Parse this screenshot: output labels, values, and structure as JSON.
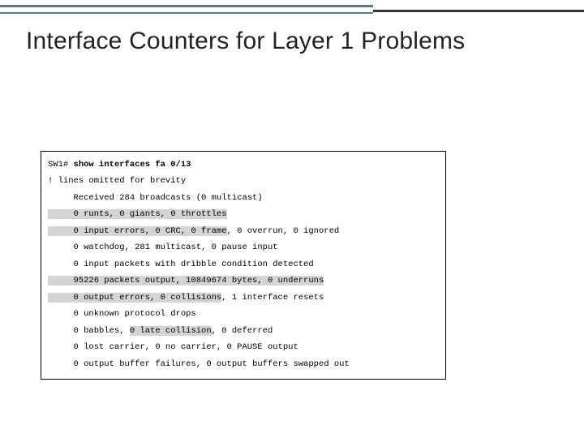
{
  "title": "Interface Counters for Layer 1 Problems",
  "cli": {
    "prompt": "SW1#",
    "command": "show interfaces fa 0/13",
    "omitted": "! lines omitted for brevity",
    "l_recv": "     Received 284 broadcasts (0 multicast)",
    "l_runts_hl": "     0 runts, 0 giants, 0 throttles",
    "l_ie_hl": "     0 input errors, 0 CRC, 0 frame",
    "l_ie_rest": ", 0 overrun, 0 ignored",
    "l_watch": "     0 watchdog, 281 multicast, 0 pause input",
    "l_dribble": "     0 input packets with dribble condition detected",
    "l_pkts_hl": "     95226 packets output, 10849674 bytes, 0 underruns",
    "l_oe_hl": "     0 output errors, 0 collisions",
    "l_oe_rest": ", 1 interface resets",
    "l_unk": "     0 unknown protocol drops",
    "l_bab_pre": "     0 babbles, ",
    "l_latecol_hl": "0 late collision",
    "l_bab_post": ", 0 deferred",
    "l_lost": "     0 lost carrier, 0 no carrier, 0 PAUSE output",
    "l_buf": "     0 output buffer failures, 0 output buffers swapped out"
  }
}
